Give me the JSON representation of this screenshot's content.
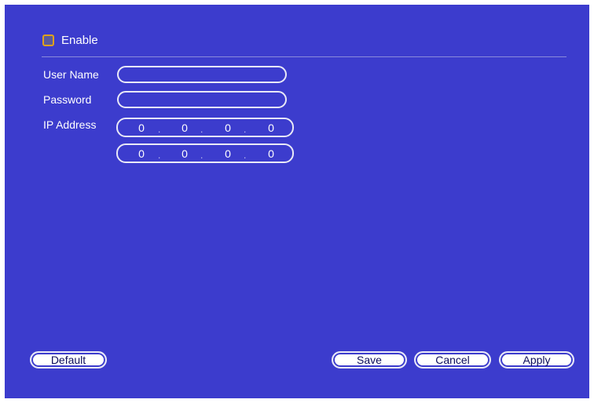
{
  "enable": {
    "label": "Enable",
    "checked": false
  },
  "fields": {
    "user_name": {
      "label": "User Name",
      "value": ""
    },
    "password": {
      "label": "Password",
      "value": ""
    },
    "ip_address": {
      "label": "IP Address"
    }
  },
  "ip1": {
    "o1": "0",
    "o2": "0",
    "o3": "0",
    "o4": "0",
    "sep": "."
  },
  "ip2": {
    "o1": "0",
    "o2": "0",
    "o3": "0",
    "o4": "0",
    "sep": "."
  },
  "buttons": {
    "default": "Default",
    "save": "Save",
    "cancel": "Cancel",
    "apply": "Apply"
  },
  "colors": {
    "panel_bg": "#3c3ccd",
    "checkbox_border": "#e0a11c",
    "text": "#ffffff",
    "button_text": "#0d0d5c"
  }
}
